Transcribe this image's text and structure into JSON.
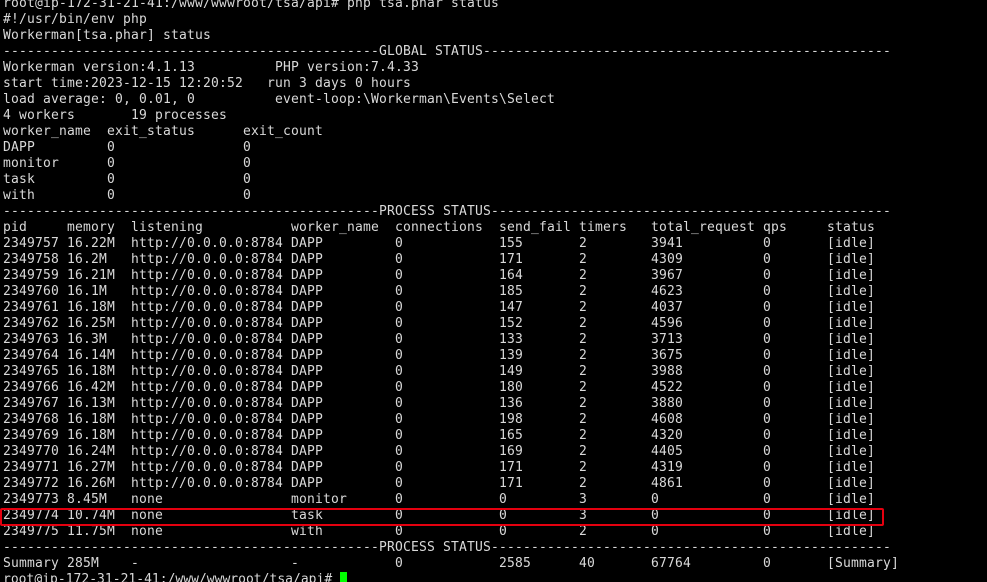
{
  "terminal": {
    "colors": {
      "background": "#000000",
      "foreground": "#d9d9d9",
      "cursor": "#00ff00",
      "highlight_border": "#e5000f"
    },
    "command_line": "root@ip-172-31-21-41:/www/wwwroot/tsa/api# php tsa.phar status",
    "shebang": "#!/usr/bin/env php",
    "app_title": "Workerman[tsa.phar] status",
    "global_status_rule": "-----------------------------------------------GLOBAL STATUS---------------------------------------------------",
    "global": {
      "versions": "Workerman version:4.1.13          PHP version:7.4.33",
      "start_time": "start time:2023-12-15 12:20:52   run 3 days 0 hours",
      "load": "load average: 0, 0.01, 0          event-loop:\\Workerman\\Events\\Select",
      "workers": "4 workers       19 processes"
    },
    "worker_table": {
      "header": "worker_name  exit_status      exit_count",
      "rows": [
        "DAPP         0                0",
        "monitor      0                0",
        "task         0                0",
        "with         0                0"
      ]
    },
    "process_status_rule": "-----------------------------------------------PROCESS STATUS--------------------------------------------------",
    "process_table": {
      "header": "pid     memory  listening           worker_name  connections  send_fail timers   total_request qps     status",
      "rows": [
        "2349757 16.22M  http://0.0.0.0:8784 DAPP         0            155       2        3941          0       [idle]",
        "2349758 16.2M   http://0.0.0.0:8784 DAPP         0            171       2        4309          0       [idle]",
        "2349759 16.21M  http://0.0.0.0:8784 DAPP         0            164       2        3967          0       [idle]",
        "2349760 16.1M   http://0.0.0.0:8784 DAPP         0            185       2        4623          0       [idle]",
        "2349761 16.18M  http://0.0.0.0:8784 DAPP         0            147       2        4037          0       [idle]",
        "2349762 16.25M  http://0.0.0.0:8784 DAPP         0            152       2        4596          0       [idle]",
        "2349763 16.3M   http://0.0.0.0:8784 DAPP         0            133       2        3713          0       [idle]",
        "2349764 16.14M  http://0.0.0.0:8784 DAPP         0            139       2        3675          0       [idle]",
        "2349765 16.18M  http://0.0.0.0:8784 DAPP         0            149       2        3988          0       [idle]",
        "2349766 16.42M  http://0.0.0.0:8784 DAPP         0            180       2        4522          0       [idle]",
        "2349767 16.13M  http://0.0.0.0:8784 DAPP         0            136       2        3880          0       [idle]",
        "2349768 16.18M  http://0.0.0.0:8784 DAPP         0            198       2        4608          0       [idle]",
        "2349769 16.18M  http://0.0.0.0:8784 DAPP         0            165       2        4320          0       [idle]",
        "2349770 16.24M  http://0.0.0.0:8784 DAPP         0            169       2        4405          0       [idle]",
        "2349771 16.27M  http://0.0.0.0:8784 DAPP         0            171       2        4319          0       [idle]",
        "2349772 16.26M  http://0.0.0.0:8784 DAPP         0            171       2        4861          0       [idle]",
        "2349773 8.45M   none                monitor      0            0         3        0             0       [idle]",
        "2349774 10.74M  none                task         0            0         3        0             0       [idle]",
        "2349775 11.75M  none                with         0            0         2        0             0       [idle]"
      ],
      "highlighted_row_index": 17
    },
    "summary": "Summary 285M    -                   -            0            2585      40       67764         0       [Summary]",
    "prompt": "root@ip-172-31-21-41:/www/wwwroot/tsa/api# "
  }
}
